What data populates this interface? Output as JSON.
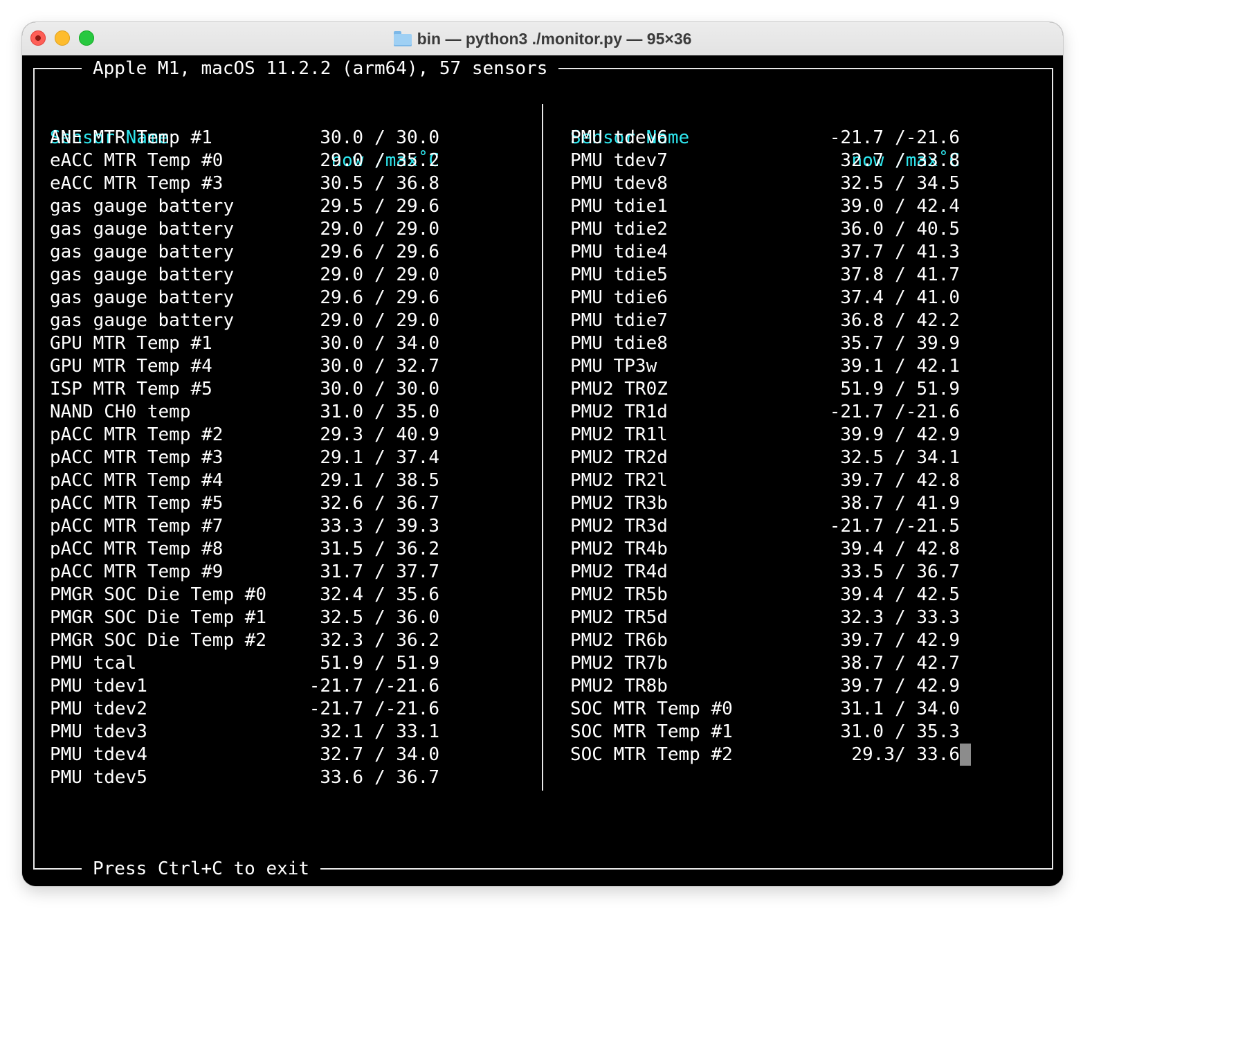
{
  "window": {
    "title": "bin — python3 ./monitor.py — 95×36",
    "folder_icon": "folder-icon"
  },
  "frame": {
    "header": "Apple M1, macOS 11.2.2 (arm64), 57 sensors",
    "footer": "Press Ctrl+C to exit"
  },
  "columns": {
    "header_name": "Sensor Name",
    "header_value": "now /max˚C"
  },
  "left_rows": [
    {
      "name": "ANE MTR Temp #1",
      "now": "30.0",
      "max": "30.0"
    },
    {
      "name": "eACC MTR Temp #0",
      "now": "29.0",
      "max": "35.2"
    },
    {
      "name": "eACC MTR Temp #3",
      "now": "30.5",
      "max": "36.8"
    },
    {
      "name": "gas gauge battery",
      "now": "29.5",
      "max": "29.6"
    },
    {
      "name": "gas gauge battery",
      "now": "29.0",
      "max": "29.0"
    },
    {
      "name": "gas gauge battery",
      "now": "29.6",
      "max": "29.6"
    },
    {
      "name": "gas gauge battery",
      "now": "29.0",
      "max": "29.0"
    },
    {
      "name": "gas gauge battery",
      "now": "29.6",
      "max": "29.6"
    },
    {
      "name": "gas gauge battery",
      "now": "29.0",
      "max": "29.0"
    },
    {
      "name": "GPU MTR Temp #1",
      "now": "30.0",
      "max": "34.0"
    },
    {
      "name": "GPU MTR Temp #4",
      "now": "30.0",
      "max": "32.7"
    },
    {
      "name": "ISP MTR Temp #5",
      "now": "30.0",
      "max": "30.0"
    },
    {
      "name": "NAND CH0 temp",
      "now": "31.0",
      "max": "35.0"
    },
    {
      "name": "pACC MTR Temp #2",
      "now": "29.3",
      "max": "40.9"
    },
    {
      "name": "pACC MTR Temp #3",
      "now": "29.1",
      "max": "37.4"
    },
    {
      "name": "pACC MTR Temp #4",
      "now": "29.1",
      "max": "38.5"
    },
    {
      "name": "pACC MTR Temp #5",
      "now": "32.6",
      "max": "36.7"
    },
    {
      "name": "pACC MTR Temp #7",
      "now": "33.3",
      "max": "39.3"
    },
    {
      "name": "pACC MTR Temp #8",
      "now": "31.5",
      "max": "36.2"
    },
    {
      "name": "pACC MTR Temp #9",
      "now": "31.7",
      "max": "37.7"
    },
    {
      "name": "PMGR SOC Die Temp #0",
      "now": "32.4",
      "max": "35.6"
    },
    {
      "name": "PMGR SOC Die Temp #1",
      "now": "32.5",
      "max": "36.0"
    },
    {
      "name": "PMGR SOC Die Temp #2",
      "now": "32.3",
      "max": "36.2"
    },
    {
      "name": "PMU tcal",
      "now": "51.9",
      "max": "51.9"
    },
    {
      "name": "PMU tdev1",
      "now": "-21.7",
      "max": "-21.6"
    },
    {
      "name": "PMU tdev2",
      "now": "-21.7",
      "max": "-21.6"
    },
    {
      "name": "PMU tdev3",
      "now": "32.1",
      "max": "33.1"
    },
    {
      "name": "PMU tdev4",
      "now": "32.7",
      "max": "34.0"
    },
    {
      "name": "PMU tdev5",
      "now": "33.6",
      "max": "36.7"
    }
  ],
  "right_rows": [
    {
      "name": "PMU tdev6",
      "now": "-21.7",
      "max": "-21.6"
    },
    {
      "name": "PMU tdev7",
      "now": "32.7",
      "max": "33.8"
    },
    {
      "name": "PMU tdev8",
      "now": "32.5",
      "max": "34.5"
    },
    {
      "name": "PMU tdie1",
      "now": "39.0",
      "max": "42.4"
    },
    {
      "name": "PMU tdie2",
      "now": "36.0",
      "max": "40.5"
    },
    {
      "name": "PMU tdie4",
      "now": "37.7",
      "max": "41.3"
    },
    {
      "name": "PMU tdie5",
      "now": "37.8",
      "max": "41.7"
    },
    {
      "name": "PMU tdie6",
      "now": "37.4",
      "max": "41.0"
    },
    {
      "name": "PMU tdie7",
      "now": "36.8",
      "max": "42.2"
    },
    {
      "name": "PMU tdie8",
      "now": "35.7",
      "max": "39.9"
    },
    {
      "name": "PMU TP3w",
      "now": "39.1",
      "max": "42.1"
    },
    {
      "name": "PMU2 TR0Z",
      "now": "51.9",
      "max": "51.9"
    },
    {
      "name": "PMU2 TR1d",
      "now": "-21.7",
      "max": "-21.6"
    },
    {
      "name": "PMU2 TR1l",
      "now": "39.9",
      "max": "42.9"
    },
    {
      "name": "PMU2 TR2d",
      "now": "32.5",
      "max": "34.1"
    },
    {
      "name": "PMU2 TR2l",
      "now": "39.7",
      "max": "42.8"
    },
    {
      "name": "PMU2 TR3b",
      "now": "38.7",
      "max": "41.9"
    },
    {
      "name": "PMU2 TR3d",
      "now": "-21.7",
      "max": "-21.5"
    },
    {
      "name": "PMU2 TR4b",
      "now": "39.4",
      "max": "42.8"
    },
    {
      "name": "PMU2 TR4d",
      "now": "33.5",
      "max": "36.7"
    },
    {
      "name": "PMU2 TR5b",
      "now": "39.4",
      "max": "42.5"
    },
    {
      "name": "PMU2 TR5d",
      "now": "32.3",
      "max": "33.3"
    },
    {
      "name": "PMU2 TR6b",
      "now": "39.7",
      "max": "42.9"
    },
    {
      "name": "PMU2 TR7b",
      "now": "38.7",
      "max": "42.7"
    },
    {
      "name": "PMU2 TR8b",
      "now": "39.7",
      "max": "42.9"
    },
    {
      "name": "SOC MTR Temp #0",
      "now": "31.1",
      "max": "34.0"
    },
    {
      "name": "SOC MTR Temp #1",
      "now": "31.0",
      "max": "35.3"
    },
    {
      "name": "SOC MTR Temp #2",
      "now": "29.3",
      "max": "33.6"
    }
  ],
  "colors": {
    "header_cyan": "#2ee6ee",
    "text": "#ffffff",
    "background": "#000000"
  }
}
